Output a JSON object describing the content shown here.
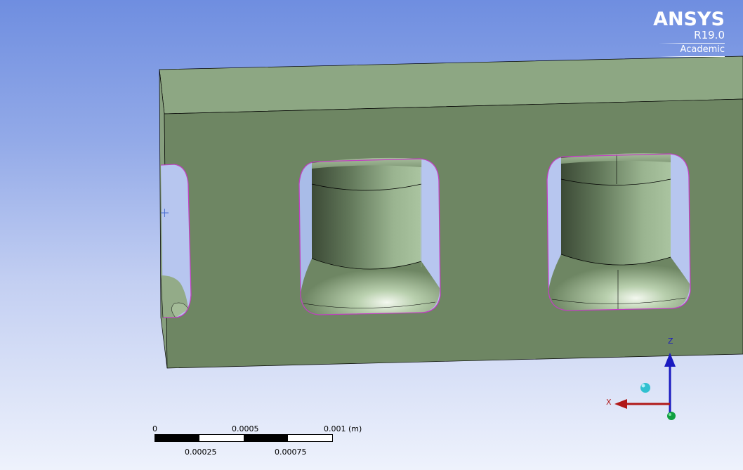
{
  "logo": {
    "name": "ANSYS",
    "version": "R19.0",
    "edition": "Academic"
  },
  "scale_bar": {
    "top_labels": [
      "0",
      "0.0005",
      "0.001 (m)"
    ],
    "bottom_labels": [
      "0.00025",
      "0.00075"
    ]
  },
  "triad": {
    "z_label": "Z",
    "x_label": "X"
  },
  "colors": {
    "top_face": "#8da783",
    "front_face": "#6e8663",
    "left_face": "#879f7e",
    "edge_highlight": "#c040c0",
    "z_axis": "#1a1ac0",
    "x_axis": "#b01818",
    "y_axis": "#10a040",
    "iso_ball": "#30c0d0"
  }
}
